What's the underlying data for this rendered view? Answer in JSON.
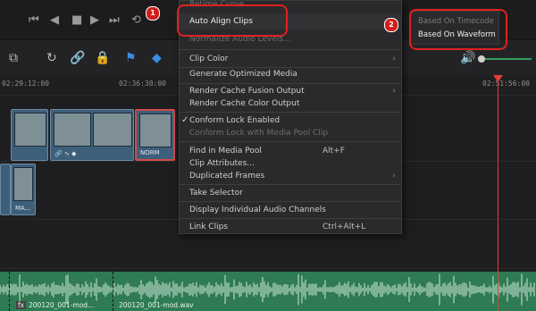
{
  "timeline": {
    "timecodes": [
      "02:29:12:00",
      "02:36:38:00",
      "02:51:56:00"
    ],
    "clips": [
      "NORM",
      "MA..."
    ],
    "audio_clips": [
      "200120_001-mod...",
      "200120_001-mod.wav"
    ],
    "audio_badge": "fx"
  },
  "menu": {
    "items": [
      {
        "label": "Retime Curve",
        "disabled": true
      },
      {
        "label": "Auto Align Clips",
        "submenu": true
      },
      {
        "label": "Normalize Audio Levels...",
        "disabled": true
      },
      {
        "label": "Clip Color",
        "submenu": true
      },
      {
        "label": "Generate Optimized Media"
      },
      {
        "label": "Render Cache Fusion Output",
        "submenu": true
      },
      {
        "label": "Render Cache Color Output"
      },
      {
        "label": "Conform Lock Enabled",
        "checked": true
      },
      {
        "label": "Conform Lock with Media Pool Clip",
        "disabled": true
      },
      {
        "label": "Find in Media Pool",
        "shortcut": "Alt+F"
      },
      {
        "label": "Clip Attributes..."
      },
      {
        "label": "Duplicated Frames",
        "submenu": true
      },
      {
        "label": "Take Selector"
      },
      {
        "label": "Display Individual Audio Channels"
      },
      {
        "label": "Link Clips",
        "shortcut": "Ctrl+Alt+L"
      }
    ]
  },
  "submenu": {
    "items": [
      {
        "label": "Based On Timecode",
        "disabled": true
      },
      {
        "label": "Based On Waveform"
      }
    ]
  },
  "annotations": [
    "1",
    "2"
  ],
  "colors": {
    "accent_red": "#e0201e",
    "clip_blue": "#3e5f7a",
    "audio_green": "#2f7b53",
    "playhead": "#e0403a"
  },
  "icons": [
    "first-frame-icon",
    "previous-frame-icon",
    "play-reverse-icon",
    "stop-icon",
    "play-icon",
    "next-frame-icon",
    "last-frame-icon",
    "loop-icon",
    "snap-icon",
    "link-icon",
    "lock-icon",
    "flag-icon",
    "marker-icon",
    "speaker-icon"
  ]
}
